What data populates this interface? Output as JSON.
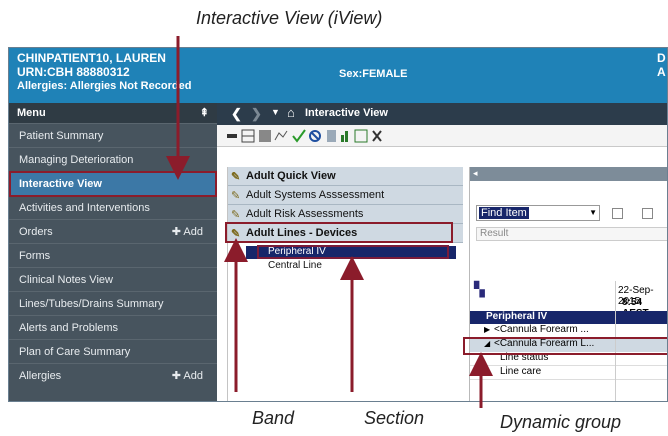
{
  "annotations": {
    "interactive_view": "Interactive View (iView)",
    "band": "Band",
    "section": "Section",
    "dynamic_group": "Dynamic group"
  },
  "banner": {
    "patient_name": "CHINPATIENT10, LAUREN",
    "urn": "URN:CBH 88880312",
    "allergies": "Allergies: Allergies Not Recorded",
    "sex": "Sex:FEMALE",
    "right_top": "D",
    "right_mid": "A"
  },
  "sidebar": {
    "menu_label": "Menu",
    "pin_glyph": "⇞",
    "add_label": "Add",
    "items": [
      {
        "label": "Patient Summary"
      },
      {
        "label": "Managing Deterioration"
      },
      {
        "label": "Interactive View"
      },
      {
        "label": "Activities and Interventions"
      },
      {
        "label": "Orders"
      },
      {
        "label": "Forms"
      },
      {
        "label": "Clinical Notes View"
      },
      {
        "label": "Lines/Tubes/Drains Summary"
      },
      {
        "label": "Alerts and Problems"
      },
      {
        "label": "Plan of Care Summary"
      },
      {
        "label": "Allergies"
      }
    ]
  },
  "toolbar": {
    "title": "Interactive View"
  },
  "bands": [
    {
      "label": "Adult Quick View"
    },
    {
      "label": "Adult Systems Asssessment"
    },
    {
      "label": "Adult Risk Assessments"
    },
    {
      "label": "Adult Lines - Devices"
    }
  ],
  "sections": [
    {
      "label": "Peripheral IV"
    },
    {
      "label": "Central Line"
    }
  ],
  "right_panel": {
    "find_item": "Find Item",
    "result": "Result",
    "date": "22-Sep-2015",
    "time": "8:54 AEST",
    "group_header": "Peripheral IV",
    "dynamic_row_1": "<Cannula Forearm ...",
    "dynamic_row_2": "<Cannula Forearm L...",
    "line_status": "Line status",
    "line_care": "Line care"
  },
  "colors": {
    "banner": "#1f82b7",
    "sidebar": "#47545e",
    "highlight_box": "#8b1c2b",
    "band": "#cfd9e2",
    "selected_section": "#17266a"
  }
}
